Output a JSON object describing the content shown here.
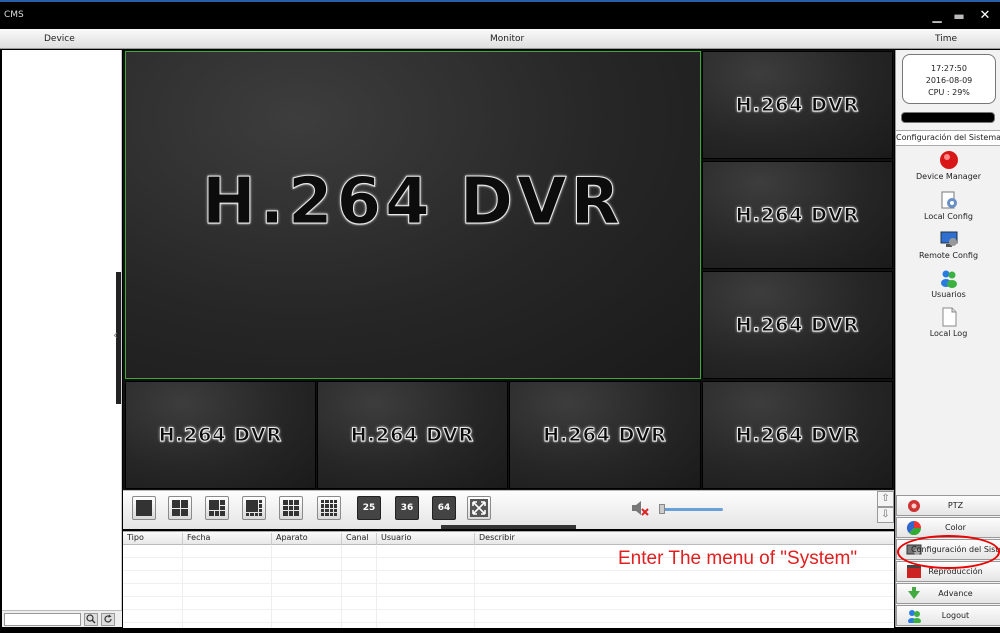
{
  "window": {
    "title": "CMS",
    "controls": {
      "minimize": "▁",
      "restore": "▬",
      "close": "✕"
    }
  },
  "columns": {
    "device": "Device",
    "monitor": "Monitor",
    "time": "Time"
  },
  "channels": [
    {
      "label": "H.264 DVR"
    },
    {
      "label": "H.264 DVR"
    },
    {
      "label": "H.264 DVR"
    },
    {
      "label": "H.264 DVR"
    },
    {
      "label": "H.264 DVR"
    },
    {
      "label": "H.264 DVR"
    },
    {
      "label": "H.264 DVR"
    },
    {
      "label": "H.264 DVR"
    }
  ],
  "toolbar": {
    "layouts": [
      "1",
      "4",
      "6",
      "8",
      "9",
      "16"
    ],
    "numbered": [
      "25",
      "36",
      "64"
    ],
    "fullscreen_icon": "fullscreen-icon",
    "volume_icon": "mute-icon",
    "volume_level": 0.05
  },
  "log": {
    "headers": [
      "Tipo",
      "Fecha",
      "Aparato",
      "Canal",
      "Usuario",
      "Describir"
    ]
  },
  "annotation": "Enter The menu of \"System\"",
  "status": {
    "time": "17:27:50",
    "date": "2016-08-09",
    "cpu": "CPU : 29%"
  },
  "system_menu": {
    "title": "Configuración del Sistema",
    "items": [
      {
        "label": "Device Manager",
        "icon": "device-manager-icon"
      },
      {
        "label": "Local Config",
        "icon": "local-config-icon"
      },
      {
        "label": "Remote Config",
        "icon": "remote-config-icon"
      },
      {
        "label": "Usuarios",
        "icon": "users-icon"
      },
      {
        "label": "Local Log",
        "icon": "log-icon"
      }
    ]
  },
  "nav": [
    {
      "label": "PTZ",
      "icon": "ptz-icon"
    },
    {
      "label": "Color",
      "icon": "color-icon"
    },
    {
      "label": "Configuración del Sistema",
      "icon": "system-config-icon"
    },
    {
      "label": "Reproducción",
      "icon": "playback-icon"
    },
    {
      "label": "Advance",
      "icon": "advance-icon"
    },
    {
      "label": "Logout",
      "icon": "logout-icon"
    }
  ],
  "colors": {
    "accent_border": "#3aaa30",
    "annotation": "#e02020",
    "title_strip": "#2a5fa8"
  }
}
